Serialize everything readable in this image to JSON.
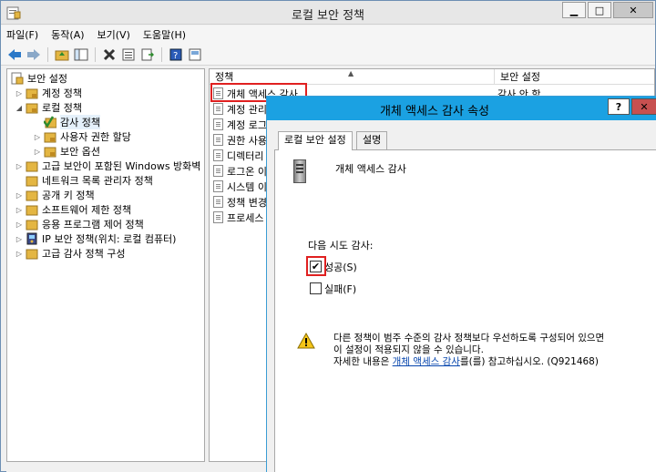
{
  "window": {
    "title": "로컬 보안 정책",
    "minimize": "▁",
    "maximize": "□",
    "close": "✕"
  },
  "menu": [
    "파일(F)",
    "동작(A)",
    "보기(V)",
    "도움말(H)"
  ],
  "tree": {
    "root": "보안 설정",
    "items": [
      {
        "label": "계정 정책",
        "level": 1
      },
      {
        "label": "로컬 정책",
        "level": 1
      },
      {
        "label": "감사 정책",
        "level": 2
      },
      {
        "label": "사용자 권한 할당",
        "level": 2
      },
      {
        "label": "보안 옵션",
        "level": 2
      },
      {
        "label": "고급 보안이 포함된 Windows 방화벽",
        "level": 1
      },
      {
        "label": "네트워크 목록 관리자 정책",
        "level": 1
      },
      {
        "label": "공개 키 정책",
        "level": 1
      },
      {
        "label": "소프트웨어 제한 정책",
        "level": 1
      },
      {
        "label": "응용 프로그램 제어 정책",
        "level": 1
      },
      {
        "label": "IP 보안 정책(위치: 로컬 컴퓨터)",
        "level": 1
      },
      {
        "label": "고급 감사 정책 구성",
        "level": 1
      }
    ]
  },
  "list": {
    "col_policy": "정책",
    "col_setting": "보안 설정",
    "rows": [
      {
        "name": "개체 액세스 감사",
        "setting": "감사 안 함"
      },
      {
        "name": "계정 관리",
        "setting": ""
      },
      {
        "name": "계정 로그",
        "setting": ""
      },
      {
        "name": "권한 사용",
        "setting": ""
      },
      {
        "name": "디렉터리",
        "setting": ""
      },
      {
        "name": "로그온 이",
        "setting": ""
      },
      {
        "name": "시스템 이",
        "setting": ""
      },
      {
        "name": "정책 변경",
        "setting": ""
      },
      {
        "name": "프로세스",
        "setting": ""
      }
    ]
  },
  "dialog": {
    "title": "개체 액세스 감사 속성",
    "help": "?",
    "close": "✕",
    "tabs": [
      "로컬 보안 설정",
      "설명"
    ],
    "policy_name": "개체 액세스 감사",
    "audit_label": "다음 시도 감사:",
    "success_label": "성공(S)",
    "success_checked": true,
    "failure_label": "실패(F)",
    "failure_checked": false,
    "warning_line1": "다른 정책이 범주 수준의 감사 정책보다 우선하도록 구성되어 있으면",
    "warning_line2": "이 설정이 적용되지 않을 수 있습니다.",
    "more_prefix": "자세한 내용은 ",
    "more_link": "개체 액세스 감사",
    "more_suffix": "를(를) 참고하십시오. (Q921468)"
  },
  "colors": {
    "dialog_title_bg": "#1ba1e2",
    "highlight": "#e02020",
    "link": "#0645ad"
  }
}
